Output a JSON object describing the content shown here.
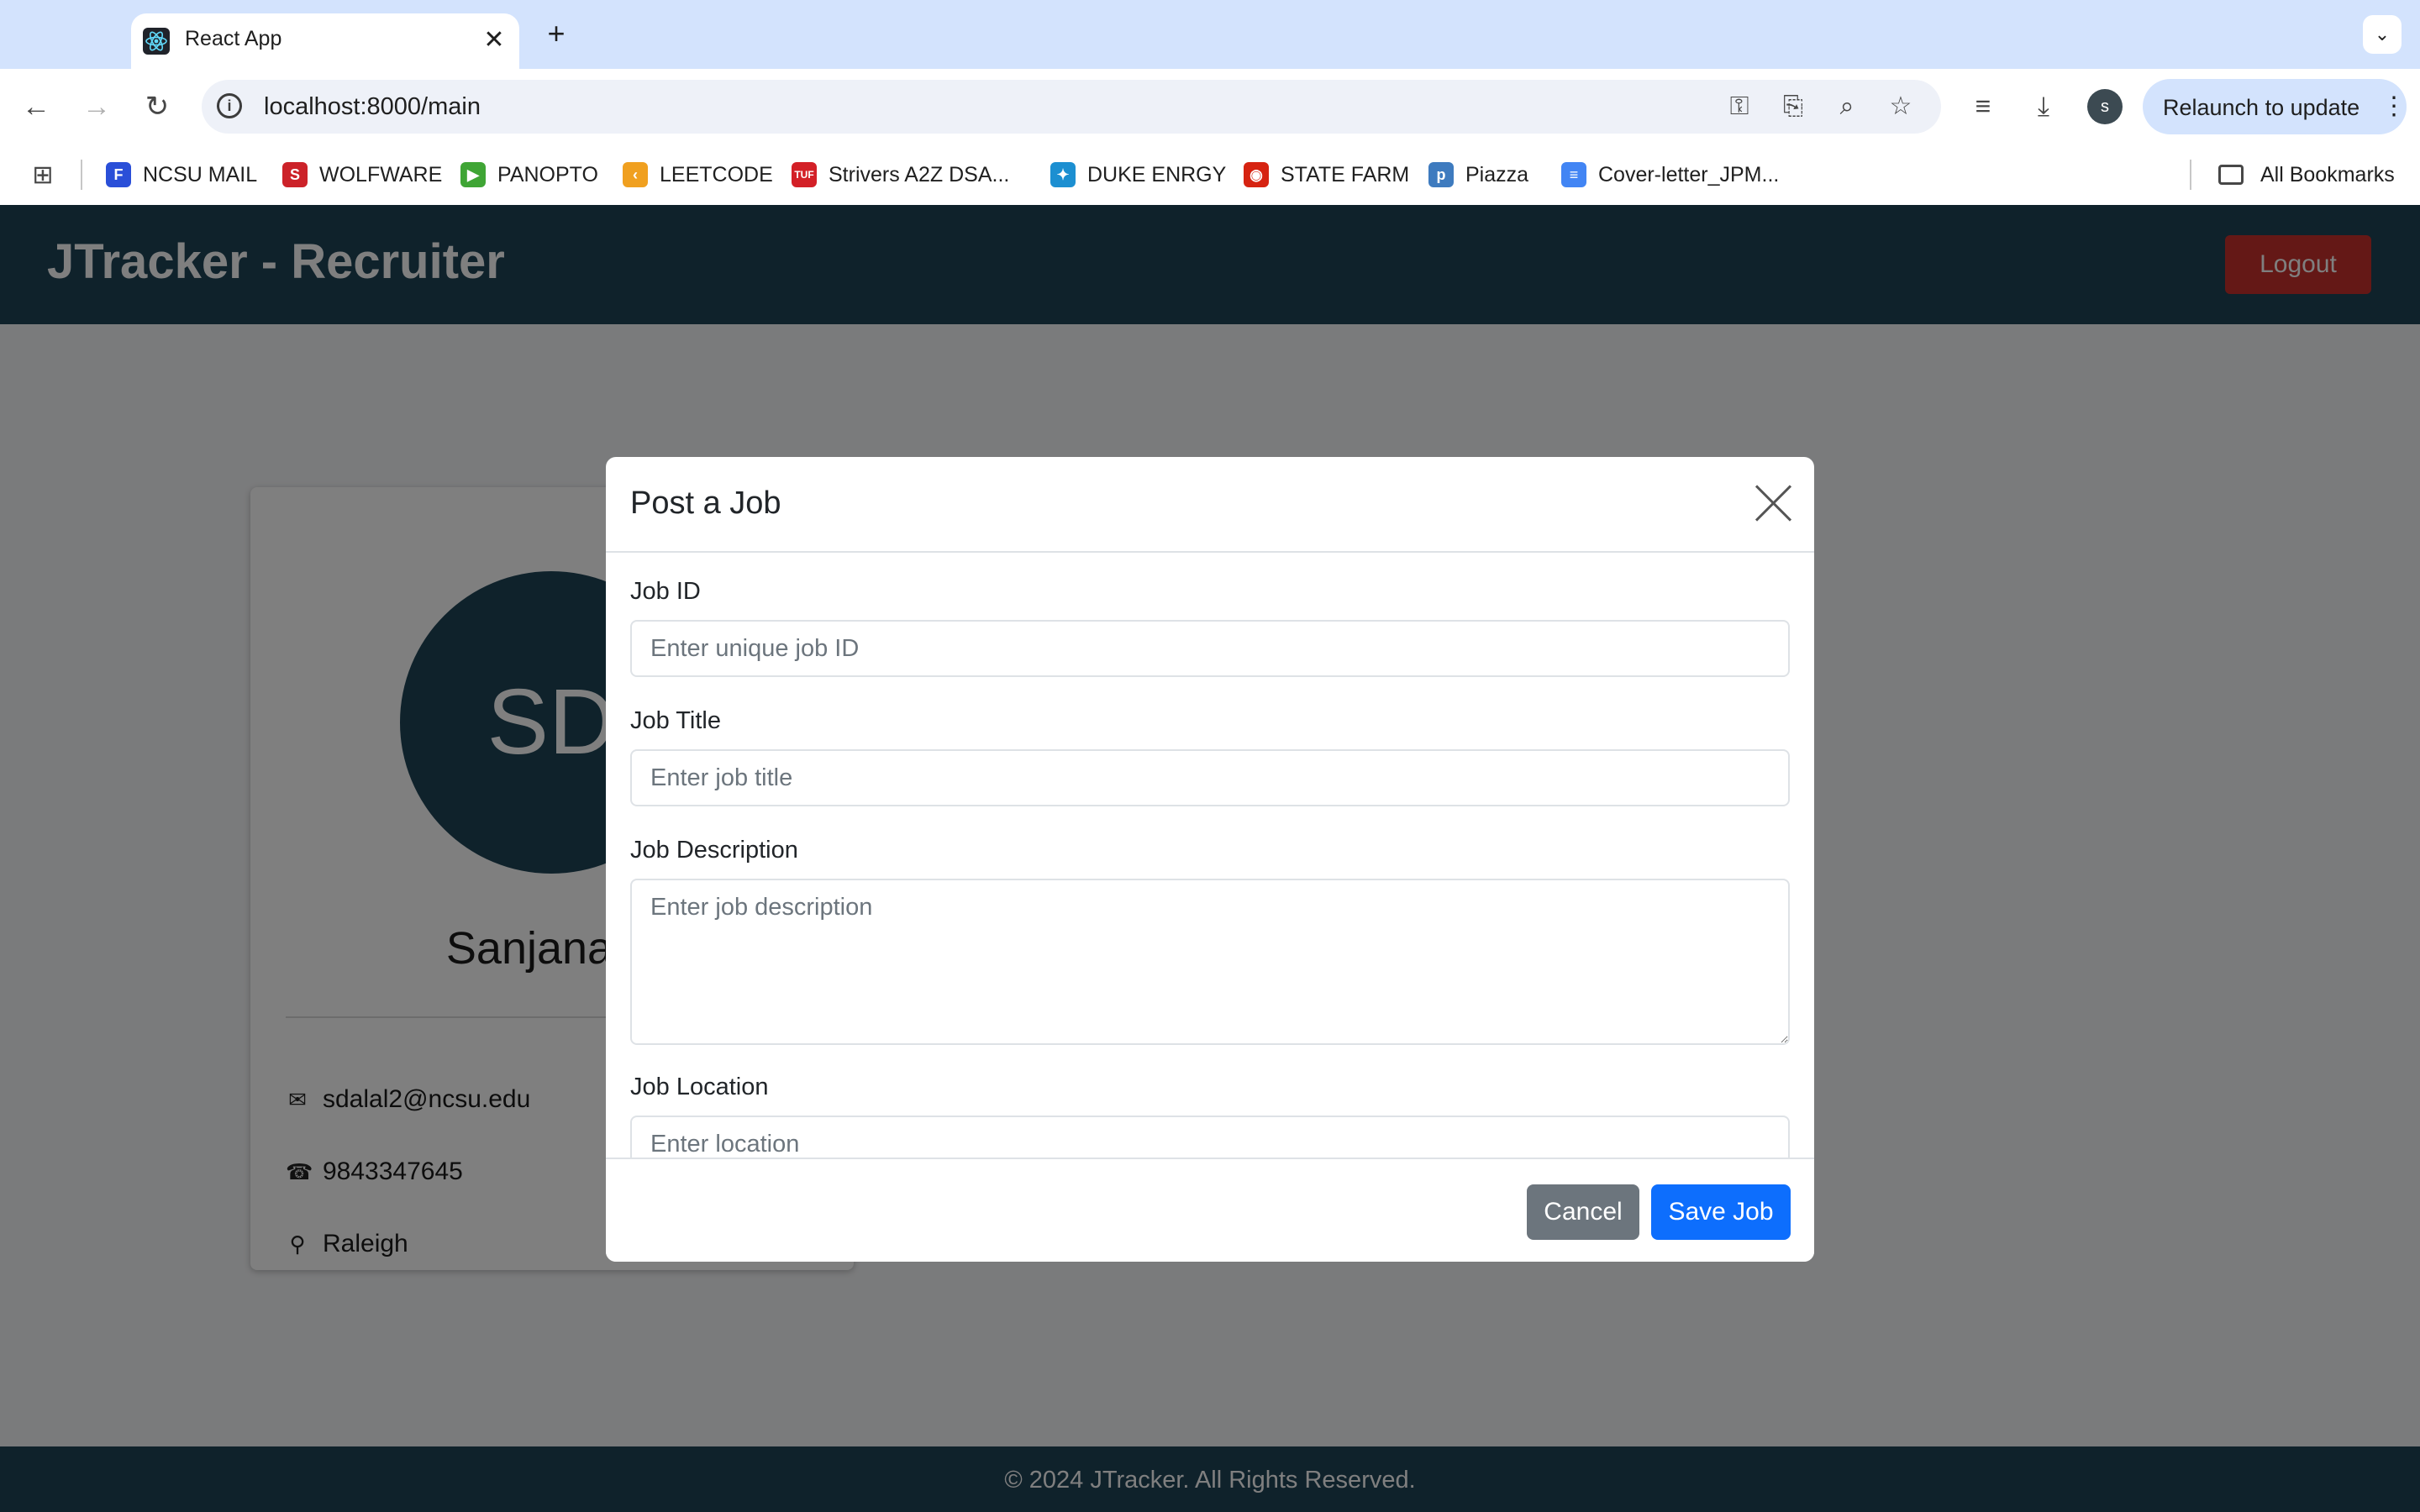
{
  "browser": {
    "tab_title": "React App",
    "url": "localhost:8000/main",
    "relaunch_label": "Relaunch to update",
    "profile_initial": "s",
    "bookmarks": [
      {
        "label": "NCSU MAIL",
        "icon": "ncsu-mail-icon",
        "color": "#2a4fd8"
      },
      {
        "label": "WOLFWARE",
        "icon": "wolfware-icon",
        "color": "#cc2229"
      },
      {
        "label": "PANOPTO",
        "icon": "panopto-icon",
        "color": "#3fa535"
      },
      {
        "label": "LEETCODE",
        "icon": "leetcode-icon",
        "color": "#f0a020"
      },
      {
        "label": "Strivers A2Z DSA...",
        "icon": "strivers-icon",
        "color": "#d32027"
      },
      {
        "label": "DUKE ENRGY",
        "icon": "duke-energy-icon",
        "color": "#1c8fd1"
      },
      {
        "label": "STATE FARM",
        "icon": "state-farm-icon",
        "color": "#d62311"
      },
      {
        "label": "Piazza",
        "icon": "piazza-icon",
        "color": "#3e7bbf"
      },
      {
        "label": "Cover-letter_JPM...",
        "icon": "google-docs-icon",
        "color": "#4285f4"
      }
    ],
    "all_bookmarks_label": "All Bookmarks"
  },
  "app": {
    "title": "JTracker - Recruiter",
    "logout_label": "Logout",
    "footer": "© 2024 JTracker. All Rights Reserved."
  },
  "profile": {
    "initials": "SD",
    "name": "Sanjana D",
    "email": "sdalal2@ncsu.edu",
    "phone": "9843347645",
    "location": "Raleigh"
  },
  "modal": {
    "title": "Post a Job",
    "fields": {
      "job_id": {
        "label": "Job ID",
        "placeholder": "Enter unique job ID"
      },
      "job_title": {
        "label": "Job Title",
        "placeholder": "Enter job title"
      },
      "job_description": {
        "label": "Job Description",
        "placeholder": "Enter job description"
      },
      "job_location": {
        "label": "Job Location",
        "placeholder": "Enter location"
      }
    },
    "cancel_label": "Cancel",
    "save_label": "Save Job"
  },
  "colors": {
    "header": "#1f4457",
    "logout": "#c9302c",
    "save": "#0d6efd",
    "cancel": "#6c757d"
  }
}
